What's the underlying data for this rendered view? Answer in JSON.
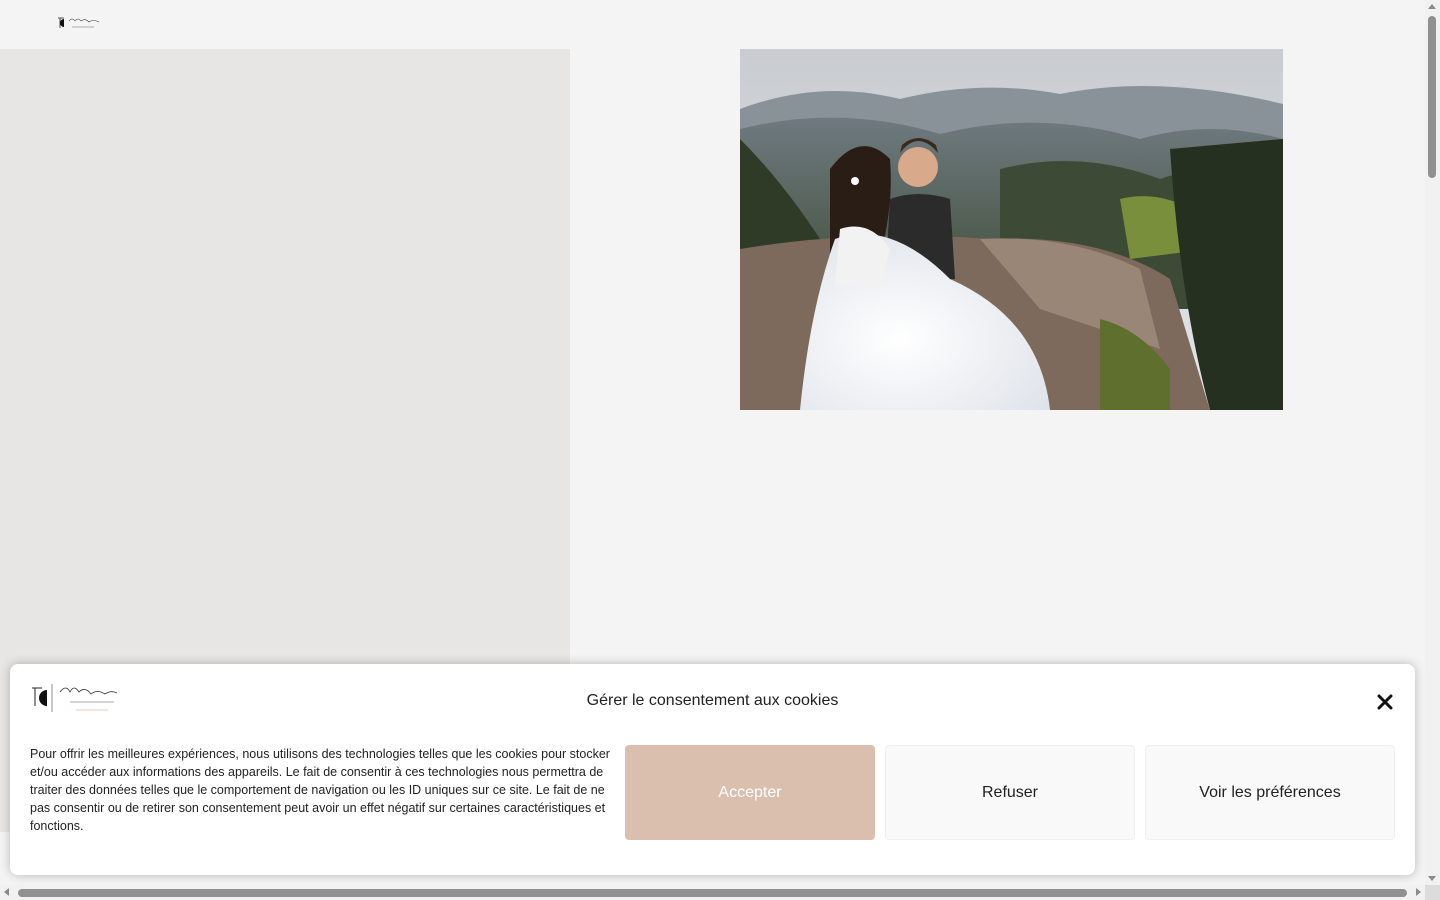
{
  "header": {
    "logo_name": "Camille Weishaeck",
    "logo_tagline": "PHOTOGRAPHE"
  },
  "photo": {
    "subject": "wedding-couple-photo"
  },
  "cookie_banner": {
    "title": "Gérer le consentement aux cookies",
    "message": "Pour offrir les meilleures expériences, nous utilisons des technologies telles que les cookies pour stocker et/ou accéder aux informations des appareils. Le fait de consentir à ces technologies nous permettra de traiter des données telles que le comportement de navigation ou les ID uniques sur ce site. Le fait de ne pas consentir ou de retirer son consentement peut avoir un effet négatif sur certaines caractéristiques et fonctions.",
    "accept_label": "Accepter",
    "refuse_label": "Refuser",
    "preferences_label": "Voir les préférences",
    "close_icon": "close-icon",
    "accent_color": "#dbbfae"
  }
}
